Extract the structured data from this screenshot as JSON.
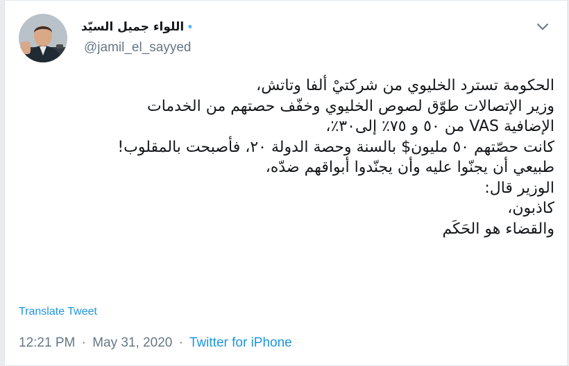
{
  "author": {
    "display_name": "اللواء جميل السيّد",
    "handle": "@jamil_el_sayyed",
    "verified": true
  },
  "tweet": {
    "lines": [
      "الحكومة تسترد الخليوي من شركتيْ ألفا وتاتش،",
      "وزير الإتصالات طوّق لصوص الخليوي وخفّف حصتهم من الخدمات",
      "الإضافية VAS من ٥٠ و ٧٥٪ إلى٣٠٪،",
      "كانت حصّتهم ٥٠ مليون$ بالسنة وحصة الدولة ٢٠، فأصبحت بالمقلوب!",
      "طبيعي أن يجنّوا عليه وأن يجنّدوا أبواقهم ضدّه،",
      "الوزير قال:",
      "كاذبون،",
      "والقضاء هو الحَكَم"
    ],
    "translate_label": "Translate Tweet",
    "time": "12:21 PM",
    "date": "May 31, 2020",
    "separator": "·",
    "source": "Twitter for iPhone"
  },
  "icons": {
    "verified": "verified-badge-icon",
    "menu": "chevron-down-icon"
  },
  "colors": {
    "accent": "#1da1f2",
    "link": "#1b95e0",
    "text": "#14171a",
    "muted": "#657786"
  }
}
